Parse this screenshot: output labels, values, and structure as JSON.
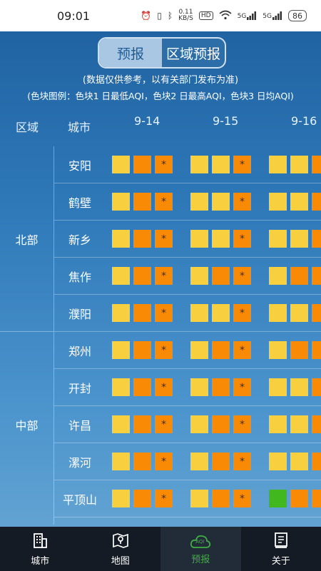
{
  "status_bar": {
    "time": "09:01",
    "speed_value": "0.11",
    "speed_unit": "KB/S",
    "hd": "HD",
    "sig1": "5G",
    "sig2": "5G",
    "battery": "86"
  },
  "tabs": [
    {
      "label": "预报",
      "active": true
    },
    {
      "label": "区域预报",
      "active": false
    }
  ],
  "note_line1": "(数据仅供参考，以有关部门发布为准)",
  "note_line2": "(色块图例：色块1 日最低AQI，色块2 日最高AQI，色块3 日均AQI)",
  "header": {
    "region": "区域",
    "city": "城市",
    "dates": [
      "9-14",
      "9-15",
      "9-16"
    ]
  },
  "colors": {
    "Y": "#f8cf3f",
    "O": "#f98a06",
    "G": "#41b81e"
  },
  "regions": [
    {
      "name": "北部",
      "start": 0,
      "count": 5
    },
    {
      "name": "中部",
      "start": 5,
      "count": 5
    }
  ],
  "cities": [
    {
      "name": "安阳",
      "days": [
        [
          "Y",
          "O",
          "O*"
        ],
        [
          "Y",
          "Y",
          "O*"
        ],
        [
          "Y",
          "Y",
          "O"
        ]
      ]
    },
    {
      "name": "鹤壁",
      "days": [
        [
          "Y",
          "O",
          "O*"
        ],
        [
          "Y",
          "Y",
          "O*"
        ],
        [
          "Y",
          "Y",
          "O"
        ]
      ]
    },
    {
      "name": "新乡",
      "days": [
        [
          "Y",
          "O",
          "O*"
        ],
        [
          "Y",
          "Y",
          "O*"
        ],
        [
          "Y",
          "Y",
          "O"
        ]
      ]
    },
    {
      "name": "焦作",
      "days": [
        [
          "Y",
          "O",
          "O*"
        ],
        [
          "Y",
          "O",
          "O*"
        ],
        [
          "Y",
          "O",
          "O"
        ]
      ]
    },
    {
      "name": "濮阳",
      "days": [
        [
          "Y",
          "O",
          "O*"
        ],
        [
          "Y",
          "Y",
          "O*"
        ],
        [
          "Y",
          "Y",
          "O"
        ]
      ]
    },
    {
      "name": "郑州",
      "days": [
        [
          "Y",
          "O",
          "O*"
        ],
        [
          "Y",
          "O",
          "O*"
        ],
        [
          "Y",
          "O",
          "O"
        ]
      ]
    },
    {
      "name": "开封",
      "days": [
        [
          "Y",
          "O",
          "O*"
        ],
        [
          "Y",
          "O",
          "O*"
        ],
        [
          "Y",
          "Y",
          "O"
        ]
      ]
    },
    {
      "name": "许昌",
      "days": [
        [
          "Y",
          "O",
          "O*"
        ],
        [
          "Y",
          "O",
          "O*"
        ],
        [
          "Y",
          "Y",
          "O"
        ]
      ]
    },
    {
      "name": "漯河",
      "days": [
        [
          "Y",
          "O",
          "O*"
        ],
        [
          "Y",
          "O",
          "O*"
        ],
        [
          "Y",
          "Y",
          "O"
        ]
      ]
    },
    {
      "name": "平顶山",
      "days": [
        [
          "Y",
          "O",
          "O*"
        ],
        [
          "Y",
          "O",
          "O*"
        ],
        [
          "G",
          "O",
          "O"
        ]
      ]
    }
  ],
  "nav": [
    {
      "label": "城市",
      "icon": "building-icon",
      "active": false
    },
    {
      "label": "地图",
      "icon": "map-icon",
      "active": false
    },
    {
      "label": "预报",
      "icon": "aqi-cloud-icon",
      "active": true,
      "badge": "AQI"
    },
    {
      "label": "关于",
      "icon": "document-icon",
      "active": false
    }
  ]
}
